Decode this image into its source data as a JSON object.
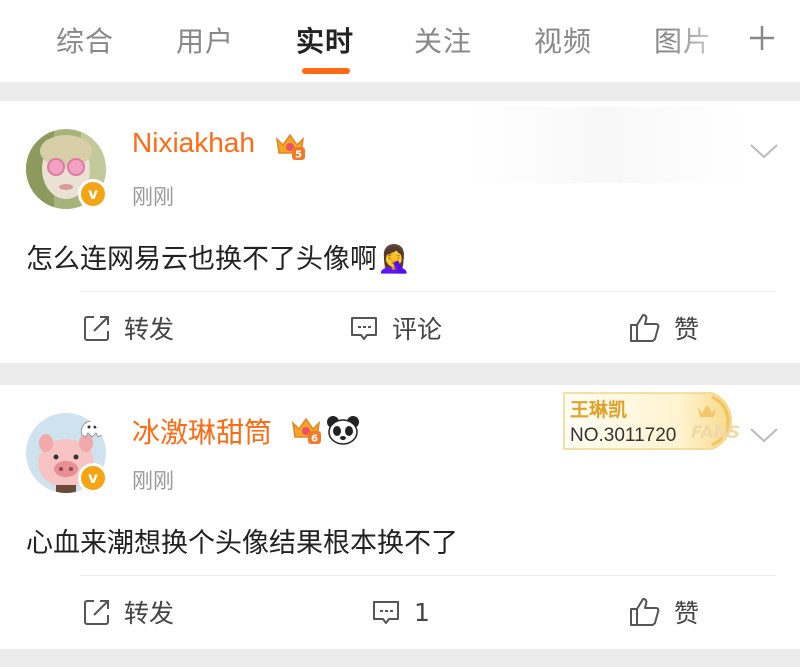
{
  "tabs": [
    {
      "label": "综合",
      "active": false
    },
    {
      "label": "用户",
      "active": false
    },
    {
      "label": "实时",
      "active": true
    },
    {
      "label": "关注",
      "active": false
    },
    {
      "label": "视频",
      "active": false
    },
    {
      "label": "图片",
      "active": false
    }
  ],
  "accent_color": "#ff6a12",
  "icons": {
    "add": "plus-icon",
    "more": "chevron-down-icon",
    "verified": "verified-badge-icon"
  },
  "posts": [
    {
      "username": "Nixiakhah",
      "level_badge": "5",
      "verified_label": "v",
      "time": "刚刚",
      "content": "怎么连网易云也换不了头像啊🤦‍♀️",
      "actions": {
        "repost": "转发",
        "comment": "评论",
        "like": "赞"
      }
    },
    {
      "username": "冰激琳甜筒",
      "level_badge": "6",
      "verified_label": "v",
      "time": "刚刚",
      "content": "心血来潮想换个头像结果根本换不了",
      "fans_badge": {
        "name": "王琳凯",
        "number": "NO.3011720",
        "label": "FANS"
      },
      "actions": {
        "repost": "转发",
        "comment": "1",
        "like": "赞"
      }
    }
  ]
}
